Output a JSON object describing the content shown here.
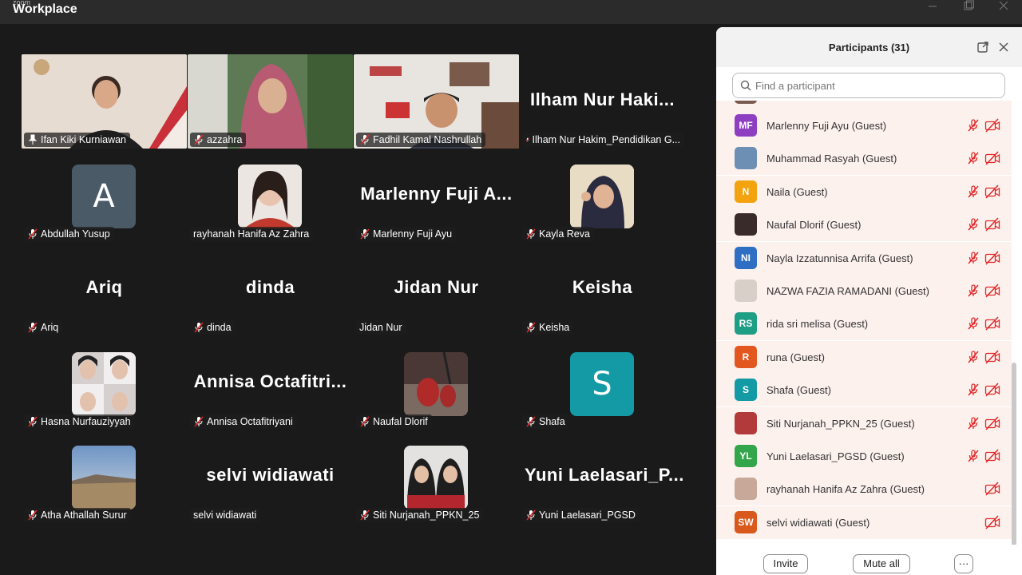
{
  "app": {
    "brand_small": "zoom",
    "brand_title": "Workplace"
  },
  "window_controls": [
    "minimize",
    "restore",
    "close"
  ],
  "gallery": {
    "tiles": [
      {
        "label": "Ifan Kiki Kurniawan",
        "pinned": true,
        "muted": false,
        "kind": "video"
      },
      {
        "label": "azzahra",
        "muted": true,
        "kind": "video"
      },
      {
        "label": "Fadhil Kamal Nashrullah",
        "muted": true,
        "kind": "video"
      },
      {
        "label": "Ilham Nur Hakim_Pendidikan G...",
        "big": "Ilham  Nur  Haki...",
        "muted": true,
        "kind": "name"
      },
      {
        "label": "Abdullah Yusup",
        "initial": "A",
        "muted": true,
        "kind": "initial"
      },
      {
        "label": "rayhanah Hanifa Az Zahra",
        "muted": false,
        "kind": "photo"
      },
      {
        "label": "Marlenny Fuji Ayu",
        "big": "Marlenny  Fuji  A...",
        "muted": true,
        "kind": "name"
      },
      {
        "label": "Kayla Reva",
        "muted": true,
        "kind": "photo"
      },
      {
        "label": "Ariq",
        "big": "Ariq",
        "muted": true,
        "kind": "name"
      },
      {
        "label": "dinda",
        "big": "dinda",
        "muted": true,
        "kind": "name"
      },
      {
        "label": "Jidan Nur",
        "big": "Jidan Nur",
        "muted": false,
        "kind": "name"
      },
      {
        "label": "Keisha",
        "big": "Keisha",
        "muted": true,
        "kind": "name"
      },
      {
        "label": "Hasna Nurfauziyyah",
        "muted": true,
        "kind": "photo"
      },
      {
        "label": "Annisa Octafitriyani",
        "big": "Annisa  Octafitri...",
        "muted": true,
        "kind": "name"
      },
      {
        "label": "Naufal Dlorif",
        "muted": true,
        "kind": "photo"
      },
      {
        "label": "Shafa",
        "initial": "S",
        "muted": true,
        "kind": "initial"
      },
      {
        "label": "Atha Athallah Surur",
        "muted": true,
        "kind": "photo"
      },
      {
        "label": "selvi widiawati",
        "big": "selvi  widiawati",
        "muted": false,
        "kind": "name"
      },
      {
        "label": "Siti Nurjanah_PPKN_25",
        "muted": true,
        "kind": "photo"
      },
      {
        "label": "Yuni Laelasari_PGSD",
        "big": "Yuni  Laelasari_P...",
        "muted": true,
        "kind": "name"
      }
    ]
  },
  "panel": {
    "title": "Participants (31)",
    "search_placeholder": "Find a participant",
    "participants": [
      {
        "initials": "MF",
        "name": "Marlenny Fuji Ayu (Guest)",
        "color": "#8e3fc1",
        "mic_muted": true
      },
      {
        "initials": "",
        "name": "Muhammad Rasyah (Guest)",
        "color": "#6c8fb3",
        "mic_muted": true
      },
      {
        "initials": "N",
        "name": "Naila (Guest)",
        "color": "#f2a30f",
        "mic_muted": true
      },
      {
        "initials": "",
        "name": "Naufal Dlorif (Guest)",
        "color": "#3a2b2b",
        "mic_muted": true
      },
      {
        "initials": "NI",
        "name": "Nayla Izzatunnisa Arrifa (Guest)",
        "color": "#2e6fc4",
        "mic_muted": true
      },
      {
        "initials": "",
        "name": "NAZWA FAZIA RAMADANI (Guest)",
        "color": "#d9cfc9",
        "mic_muted": true
      },
      {
        "initials": "RS",
        "name": "rida sri melisa (Guest)",
        "color": "#1f9e86",
        "mic_muted": true
      },
      {
        "initials": "R",
        "name": "runa (Guest)",
        "color": "#e2571f",
        "mic_muted": true
      },
      {
        "initials": "S",
        "name": "Shafa (Guest)",
        "color": "#149aa5",
        "mic_muted": true
      },
      {
        "initials": "",
        "name": "Siti Nurjanah_PPKN_25 (Guest)",
        "color": "#b33a3a",
        "mic_muted": true
      },
      {
        "initials": "YL",
        "name": "Yuni Laelasari_PGSD (Guest)",
        "color": "#33a64b",
        "mic_muted": true
      },
      {
        "initials": "",
        "name": "rayhanah Hanifa Az Zahra (Guest)",
        "color": "#c8a898",
        "mic_muted": false
      },
      {
        "initials": "SW",
        "name": "selvi widiawati (Guest)",
        "color": "#d9581b",
        "mic_muted": false
      }
    ],
    "footer": {
      "invite": "Invite",
      "mute_all": "Mute all",
      "more": "···"
    }
  }
}
